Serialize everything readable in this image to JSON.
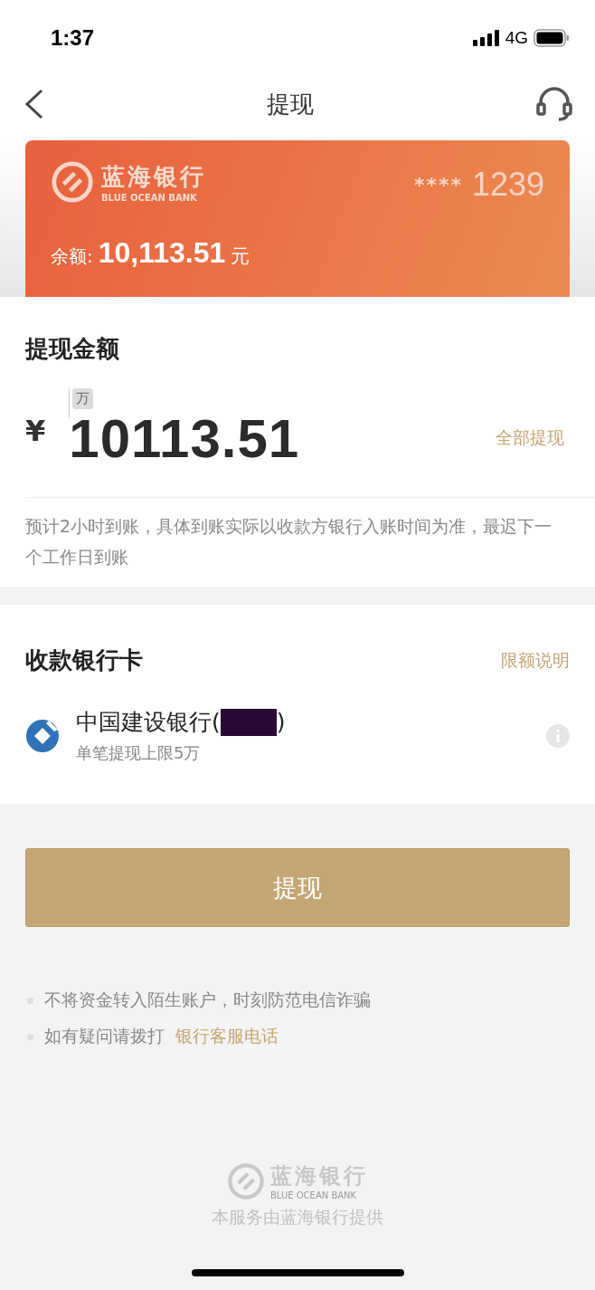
{
  "status_bar": {
    "time": "1:37",
    "network": "4G"
  },
  "nav": {
    "title": "提现"
  },
  "card": {
    "bank_name": "蓝海银行",
    "bank_name_en": "BLUE OCEAN BANK",
    "card_mask": "****",
    "card_last4": "1239",
    "balance_label": "余额:",
    "balance": "10,113.51",
    "balance_unit": "元"
  },
  "amount_section": {
    "title": "提现金额",
    "currency": "¥",
    "unit_hint": "万",
    "value": "10113.51",
    "withdraw_all": "全部提现",
    "note": "预计2小时到账，具体到账实际以收款方银行入账时间为准，最迟下一个工作日到账"
  },
  "bank_section": {
    "title": "收款银行卡",
    "limit_link": "限额说明",
    "bank_name": "中国建设银行(",
    "bank_name_end": ")",
    "redacted": true,
    "limit": "单笔提现上限5万"
  },
  "submit_button": "提现",
  "notices": [
    {
      "text": "不将资金转入陌生账户，时刻防范电信诈骗"
    },
    {
      "text": "如有疑问请拨打",
      "link": "银行客服电话"
    }
  ],
  "footer": {
    "bank_name": "蓝海银行",
    "bank_name_en": "BLUE OCEAN BANK",
    "provider": "本服务由蓝海银行提供"
  }
}
